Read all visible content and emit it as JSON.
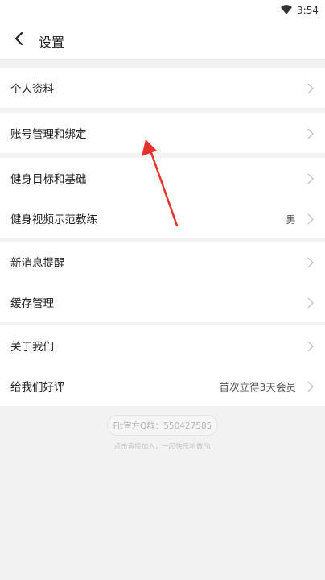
{
  "status_bar": {
    "time": "3:54"
  },
  "header": {
    "title": "设置"
  },
  "groups": [
    {
      "items": [
        {
          "label": "个人资料",
          "value": ""
        }
      ]
    },
    {
      "items": [
        {
          "label": "账号管理和绑定",
          "value": ""
        }
      ]
    },
    {
      "items": [
        {
          "label": "健身目标和基础",
          "value": ""
        },
        {
          "label": "健身视频示范教练",
          "value": "男"
        }
      ]
    },
    {
      "items": [
        {
          "label": "新消息提醒",
          "value": ""
        },
        {
          "label": "缓存管理",
          "value": ""
        }
      ]
    },
    {
      "items": [
        {
          "label": "关于我们",
          "value": ""
        },
        {
          "label": "给我们好评",
          "value": "首次立得3天会员"
        }
      ]
    }
  ],
  "footer": {
    "qq_group": "Fit官方Q群：550427585",
    "note": "点击直接加入，一起快乐地做Fit"
  },
  "annotation_color": "#e5322d",
  "icons": {
    "wifi": "wifi-icon",
    "back": "back-arrow-icon",
    "chevron": "chevron-right-icon"
  }
}
